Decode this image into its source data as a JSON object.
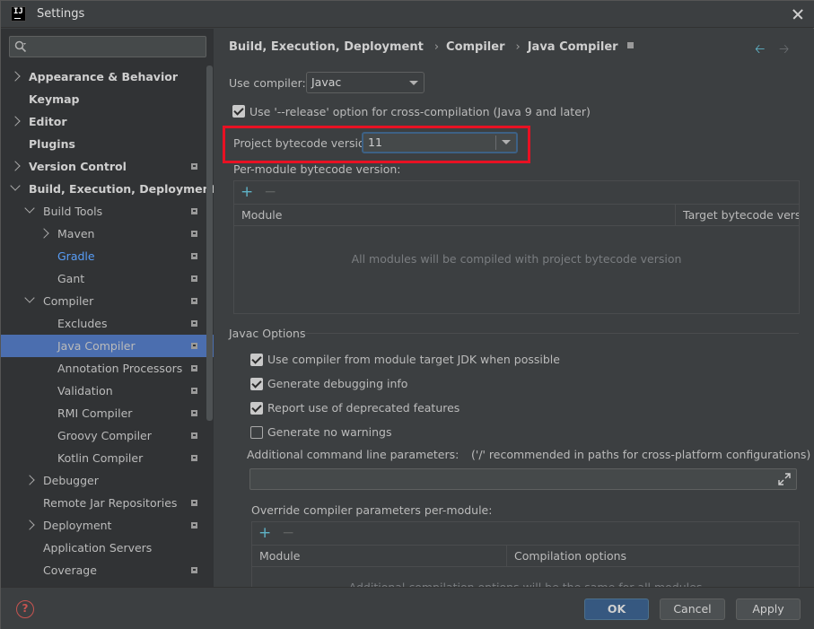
{
  "window": {
    "title": "Settings",
    "logo": "IJ"
  },
  "search": {
    "placeholder": ""
  },
  "sidebar": {
    "items": [
      {
        "label": "Appearance & Behavior",
        "level": 0,
        "arrow": "right",
        "bold": true,
        "pin": false
      },
      {
        "label": "Keymap",
        "level": 0,
        "arrow": "none",
        "bold": true,
        "pin": false
      },
      {
        "label": "Editor",
        "level": 0,
        "arrow": "right",
        "bold": true,
        "pin": false
      },
      {
        "label": "Plugins",
        "level": 0,
        "arrow": "none",
        "bold": true,
        "pin": false
      },
      {
        "label": "Version Control",
        "level": 0,
        "arrow": "right",
        "bold": true,
        "pin": true
      },
      {
        "label": "Build, Execution, Deployment",
        "level": 0,
        "arrow": "down",
        "bold": true,
        "pin": false
      },
      {
        "label": "Build Tools",
        "level": 1,
        "arrow": "down",
        "pin": true
      },
      {
        "label": "Maven",
        "level": 2,
        "arrow": "right",
        "pin": true
      },
      {
        "label": "Gradle",
        "level": 2,
        "arrow": "none",
        "pin": true,
        "link": true
      },
      {
        "label": "Gant",
        "level": 2,
        "arrow": "none",
        "pin": true
      },
      {
        "label": "Compiler",
        "level": 1,
        "arrow": "down",
        "pin": true
      },
      {
        "label": "Excludes",
        "level": 2,
        "arrow": "none",
        "pin": true
      },
      {
        "label": "Java Compiler",
        "level": 2,
        "arrow": "none",
        "pin": true,
        "selected": true
      },
      {
        "label": "Annotation Processors",
        "level": 2,
        "arrow": "none",
        "pin": true
      },
      {
        "label": "Validation",
        "level": 2,
        "arrow": "none",
        "pin": true
      },
      {
        "label": "RMI Compiler",
        "level": 2,
        "arrow": "none",
        "pin": true
      },
      {
        "label": "Groovy Compiler",
        "level": 2,
        "arrow": "none",
        "pin": true
      },
      {
        "label": "Kotlin Compiler",
        "level": 2,
        "arrow": "none",
        "pin": true
      },
      {
        "label": "Debugger",
        "level": 1,
        "arrow": "right",
        "pin": false
      },
      {
        "label": "Remote Jar Repositories",
        "level": 1,
        "arrow": "none",
        "pin": true
      },
      {
        "label": "Deployment",
        "level": 1,
        "arrow": "right",
        "pin": true
      },
      {
        "label": "Application Servers",
        "level": 1,
        "arrow": "none",
        "pin": false
      },
      {
        "label": "Coverage",
        "level": 1,
        "arrow": "none",
        "pin": true
      }
    ]
  },
  "breadcrumb": [
    "Build, Execution, Deployment",
    "Compiler",
    "Java Compiler"
  ],
  "form": {
    "use_compiler_label": "Use compiler:",
    "use_compiler_value": "Javac",
    "release_option_label": "Use '--release' option for cross-compilation (Java 9 and later)",
    "release_option_checked": true,
    "bytecode_label": "Project bytecode version:",
    "bytecode_value": "11",
    "per_module_label": "Per-module bytecode version:",
    "module_table": {
      "columns": [
        "Module",
        "Target bytecode vers..."
      ],
      "empty_text": "All modules will be compiled with project bytecode version"
    },
    "javac_section": "Javac Options",
    "options": [
      {
        "label": "Use compiler from module target JDK when possible",
        "checked": true
      },
      {
        "label": "Generate debugging info",
        "checked": true
      },
      {
        "label": "Report use of deprecated features",
        "checked": true
      },
      {
        "label": "Generate no warnings",
        "checked": false
      }
    ],
    "additional_params_label": "Additional command line parameters:",
    "additional_params_hint": "('/' recommended in paths for cross-platform configurations)",
    "additional_params_value": "",
    "override_label": "Override compiler parameters per-module:",
    "override_table": {
      "columns": [
        "Module",
        "Compilation options"
      ],
      "empty_text": "Additional compilation options will be the same for all modules"
    }
  },
  "buttons": {
    "ok": "OK",
    "cancel": "Cancel",
    "apply": "Apply",
    "help": "?"
  }
}
